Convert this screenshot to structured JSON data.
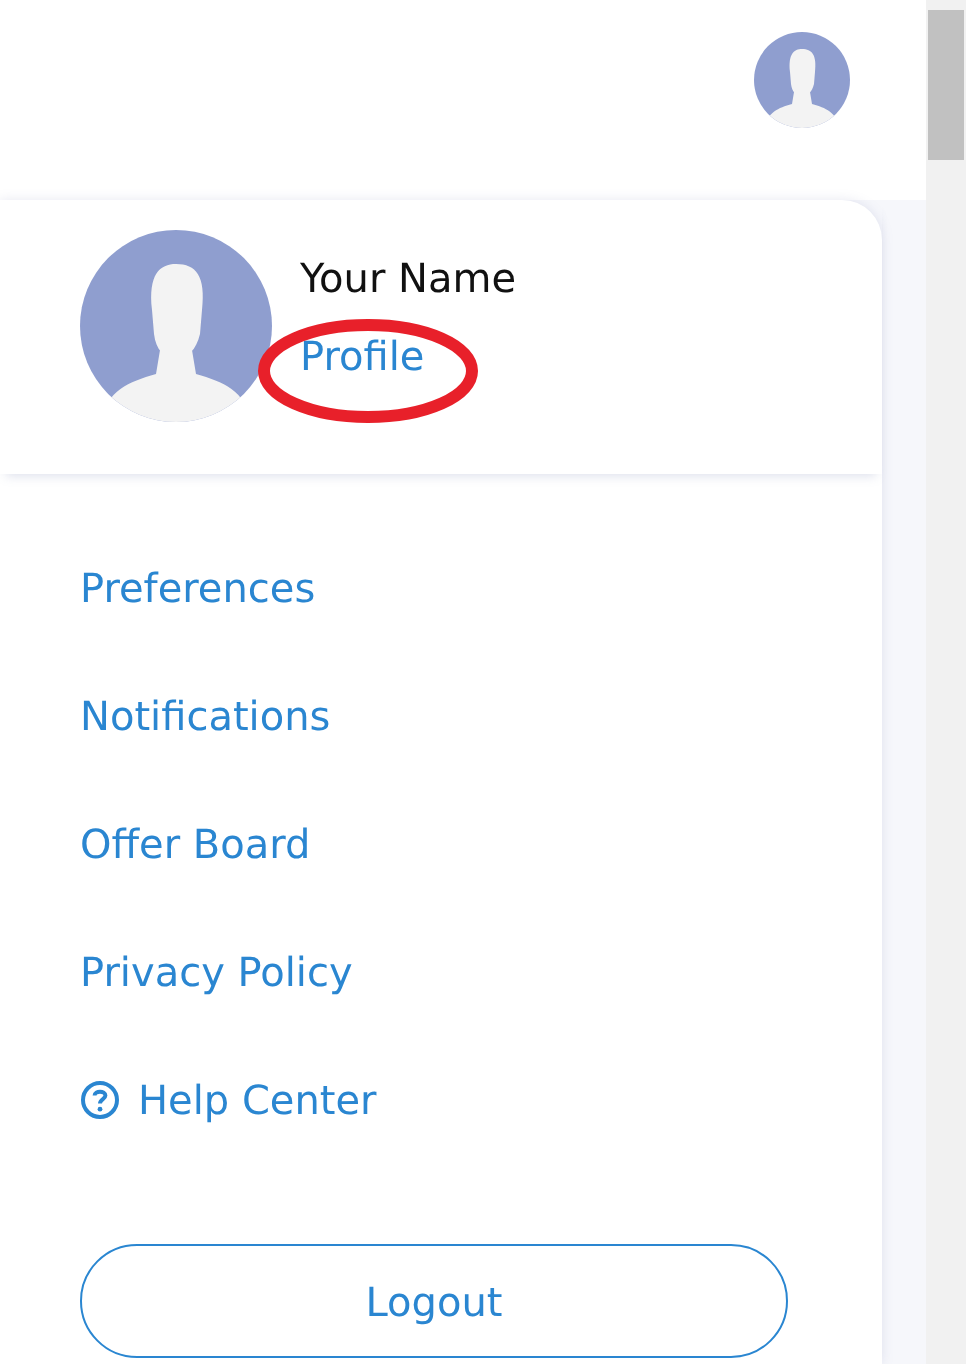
{
  "profile": {
    "name": "Your Name",
    "link": "Profile"
  },
  "menu": [
    {
      "label": "Preferences",
      "kind": "link"
    },
    {
      "label": "Notifications",
      "kind": "link"
    },
    {
      "label": "Offer Board",
      "kind": "link"
    },
    {
      "label": "Privacy Policy",
      "kind": "link"
    },
    {
      "label": "Help Center",
      "kind": "help"
    }
  ],
  "logout": "Logout"
}
